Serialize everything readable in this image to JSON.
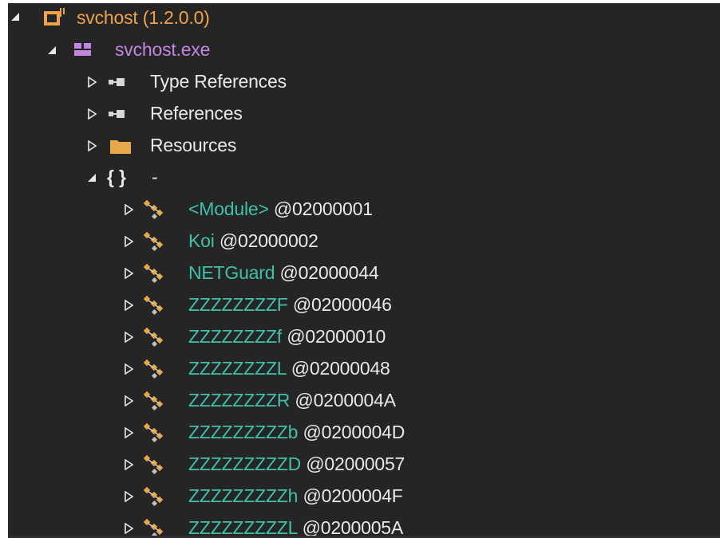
{
  "tree": {
    "root": {
      "name": "svchost (1.2.0.0)",
      "icon": "assembly-icon",
      "expanded": true
    },
    "module": {
      "name": "svchost.exe",
      "icon": "module-icon",
      "expanded": true
    },
    "folders": [
      {
        "name": "Type References",
        "icon": "references-icon"
      },
      {
        "name": "References",
        "icon": "references-icon"
      },
      {
        "name": "Resources",
        "icon": "folder-icon"
      }
    ],
    "namespace": {
      "name": "-",
      "braces": "{ }",
      "expanded": true
    },
    "types": [
      {
        "name": "<Module>",
        "token": "@02000001"
      },
      {
        "name": "Koi",
        "token": "@02000002"
      },
      {
        "name": "NETGuard",
        "token": "@02000044"
      },
      {
        "name": "ZZZZZZZZF",
        "token": "@02000046"
      },
      {
        "name": "ZZZZZZZZf",
        "token": "@02000010"
      },
      {
        "name": "ZZZZZZZZL",
        "token": "@02000048"
      },
      {
        "name": "ZZZZZZZZR",
        "token": "@0200004A"
      },
      {
        "name": "ZZZZZZZZZb",
        "token": "@0200004D"
      },
      {
        "name": "ZZZZZZZZZD",
        "token": "@02000057"
      },
      {
        "name": "ZZZZZZZZZh",
        "token": "@0200004F"
      },
      {
        "name": "ZZZZZZZZZL",
        "token": "@0200005A"
      }
    ]
  },
  "colors": {
    "background": "#252526",
    "assembly": "#f0a24a",
    "module": "#c386e0",
    "type": "#3fc1a9",
    "text": "#e8e8e8"
  }
}
